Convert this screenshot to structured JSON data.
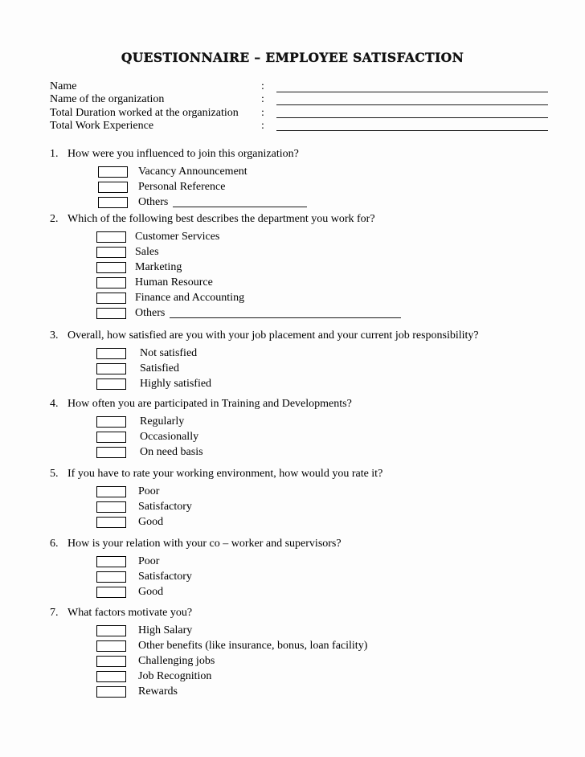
{
  "document": {
    "title": "QUESTIONNAIRE – EMPLOYEE SATISFACTION"
  },
  "header": {
    "colon": ":",
    "fields": [
      {
        "label": "Name",
        "value": ""
      },
      {
        "label": "Name of the organization",
        "value": ""
      },
      {
        "label": "Total Duration worked at the organization",
        "value": ""
      },
      {
        "label": "Total Work Experience",
        "value": ""
      }
    ]
  },
  "questions": [
    {
      "number": "1.",
      "text": "How were you influenced to join this organization?",
      "options": [
        {
          "label": "Vacancy Announcement",
          "checked": false,
          "write_in": false
        },
        {
          "label": "Personal Reference",
          "checked": false,
          "write_in": false
        },
        {
          "label": "Others",
          "checked": false,
          "write_in": true,
          "rule_width": 167
        }
      ]
    },
    {
      "number": "2.",
      "text": "Which of the following best describes the department you work for?",
      "options": [
        {
          "label": "Customer Services",
          "checked": false,
          "write_in": false
        },
        {
          "label": "Sales",
          "checked": false,
          "write_in": false
        },
        {
          "label": "Marketing",
          "checked": false,
          "write_in": false
        },
        {
          "label": "Human Resource",
          "checked": false,
          "write_in": false
        },
        {
          "label": "Finance and Accounting",
          "checked": false,
          "write_in": false
        },
        {
          "label": "Others",
          "checked": false,
          "write_in": true,
          "rule_width": 288
        }
      ]
    },
    {
      "number": "3.",
      "text": "Overall, how satisfied are you with your job placement and your current job responsibility?",
      "options": [
        {
          "label": "Not satisfied",
          "checked": false,
          "write_in": false
        },
        {
          "label": "Satisfied",
          "checked": false,
          "write_in": false
        },
        {
          "label": "Highly satisfied",
          "checked": false,
          "write_in": false
        }
      ]
    },
    {
      "number": "4.",
      "text": "How often you are participated in Training and Developments?",
      "options": [
        {
          "label": "Regularly",
          "checked": false,
          "write_in": false
        },
        {
          "label": "Occasionally",
          "checked": false,
          "write_in": false
        },
        {
          "label": "On need basis",
          "checked": false,
          "write_in": false
        }
      ]
    },
    {
      "number": "5.",
      "text": "If you have to rate your working environment, how would you rate it?",
      "options": [
        {
          "label": "Poor",
          "checked": false,
          "write_in": false
        },
        {
          "label": "Satisfactory",
          "checked": false,
          "write_in": false
        },
        {
          "label": "Good",
          "checked": false,
          "write_in": false
        }
      ]
    },
    {
      "number": "6.",
      "text": "How is your relation with your co – worker and supervisors?",
      "options": [
        {
          "label": "Poor",
          "checked": false,
          "write_in": false
        },
        {
          "label": "Satisfactory",
          "checked": false,
          "write_in": false
        },
        {
          "label": "Good",
          "checked": false,
          "write_in": false
        }
      ]
    },
    {
      "number": "7.",
      "text": "What factors motivate you?",
      "options": [
        {
          "label": "High Salary",
          "checked": false,
          "write_in": false
        },
        {
          "label": "Other benefits (like insurance, bonus, loan facility)",
          "checked": false,
          "write_in": false
        },
        {
          "label": "Challenging jobs",
          "checked": false,
          "write_in": false
        },
        {
          "label": "Job Recognition",
          "checked": false,
          "write_in": false
        },
        {
          "label": "Rewards",
          "checked": false,
          "write_in": false
        }
      ]
    }
  ]
}
